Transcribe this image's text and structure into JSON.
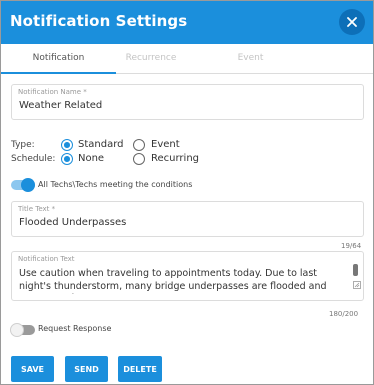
{
  "dialog": {
    "title": "Notification Settings",
    "close_icon": "close-icon"
  },
  "tabs": [
    {
      "label": "Notification",
      "active": true
    },
    {
      "label": "Recurrence",
      "active": false
    },
    {
      "label": "Event",
      "active": false
    }
  ],
  "notification_name": {
    "label": "Notification Name *",
    "value": "Weather Related"
  },
  "type": {
    "label": "Type:",
    "options": [
      {
        "label": "Standard",
        "checked": true
      },
      {
        "label": "Event",
        "checked": false
      }
    ]
  },
  "schedule": {
    "label": "Schedule:",
    "options": [
      {
        "label": "None",
        "checked": true
      },
      {
        "label": "Recurring",
        "checked": false
      }
    ]
  },
  "techs_toggle": {
    "label": "All Techs\\Techs meeting the conditions",
    "on": true
  },
  "title_text": {
    "label": "Title Text *",
    "value": "Flooded Underpasses",
    "counter": "19/64"
  },
  "notification_text": {
    "label": "Notification Text",
    "value": "Use caution when traveling to appointments today. Due to last night's thunderstorm, many bridge underpasses are flooded and some may be",
    "counter": "180/200"
  },
  "request_response": {
    "label": "Request Response",
    "on": false
  },
  "buttons": {
    "save": "SAVE",
    "send": "SEND",
    "delete": "DELETE"
  },
  "colors": {
    "accent": "#1b8fdc",
    "header_close_bg": "#0d6fb8"
  }
}
